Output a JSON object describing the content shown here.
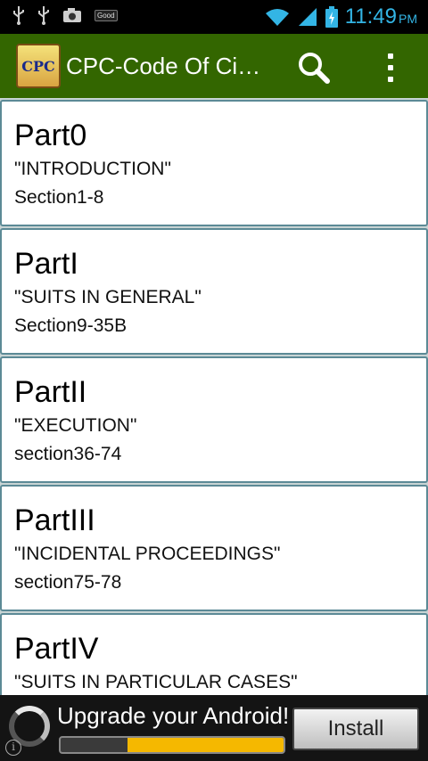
{
  "status_bar": {
    "left_icons": [
      "usb-icon",
      "usb-icon",
      "camera-icon",
      "good-badge"
    ],
    "good_label": "Good",
    "right_icons": [
      "wifi-icon",
      "signal-icon",
      "battery-charging-icon"
    ],
    "time": "11:49",
    "ampm": "PM",
    "clock_color": "#33b5e5"
  },
  "action_bar": {
    "app_icon_label": "CPC",
    "title": "CPC-Code Of Civil Procedure",
    "background": "#336600",
    "icons": [
      "search-icon",
      "overflow-menu-icon"
    ]
  },
  "parts": [
    {
      "part": "Part0",
      "title": "\"INTRODUCTION\"",
      "section": "Section1-8"
    },
    {
      "part": "PartI",
      "title": "\"SUITS IN GENERAL\"",
      "section": "Section9-35B"
    },
    {
      "part": "PartII",
      "title": "\"EXECUTION\"",
      "section": "section36-74"
    },
    {
      "part": "PartIII",
      "title": "\"INCIDENTAL PROCEEDINGS\"",
      "section": "section75-78"
    },
    {
      "part": "PartIV",
      "title": "\"SUITS IN PARTICULAR CASES\"",
      "section": ""
    }
  ],
  "ad": {
    "headline": "Upgrade your Android!",
    "install_label": "Install",
    "progress_fraction": 0.3,
    "progress_color": "#f5b800",
    "info_icon": "info-icon"
  }
}
